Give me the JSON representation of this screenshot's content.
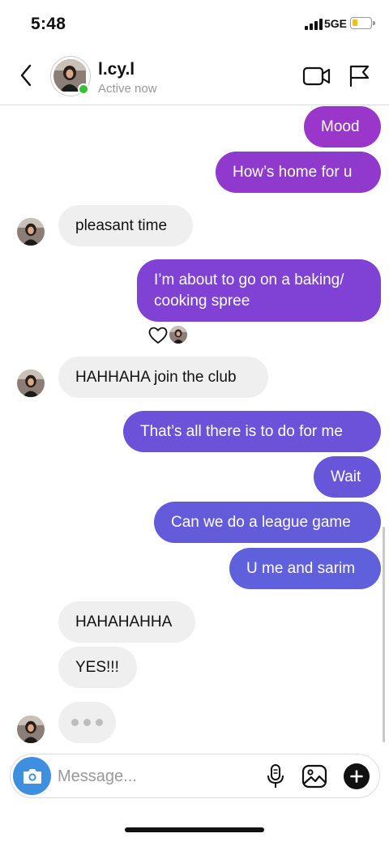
{
  "status_bar": {
    "time": "5:48",
    "network": "5GE"
  },
  "header": {
    "contact_name": "l.cy.l",
    "contact_status": "Active now"
  },
  "colors": {
    "sent_top": "#9a36c9",
    "sent_mid": "#7a45d6",
    "sent_bottom": "#5f60db",
    "received_bg": "#efefef",
    "active_green": "#35c02f",
    "camera_blue": "#3f8fe0"
  },
  "messages": [
    {
      "from": "me",
      "text": "Mood"
    },
    {
      "from": "me",
      "text": "How’s home for u"
    },
    {
      "from": "them",
      "text": "pleasant time"
    },
    {
      "from": "me",
      "text": "I’m about to go on a baking/ cooking spree",
      "reaction": "heart-icon"
    },
    {
      "from": "them",
      "text": "HAHHAHA join the club"
    },
    {
      "from": "me",
      "text": "That’s all there is to do for me"
    },
    {
      "from": "me",
      "text": "Wait"
    },
    {
      "from": "me",
      "text": "Can we do a league game"
    },
    {
      "from": "me",
      "text": "U me and sarim"
    },
    {
      "from": "them",
      "text": "HAHAHAHHA"
    },
    {
      "from": "them",
      "text": "YES!!!"
    }
  ],
  "typing_indicator": "typing-dots",
  "composer": {
    "placeholder": "Message..."
  },
  "icons": {
    "back": "chevron-left-icon",
    "video": "video-camera-icon",
    "flag": "flag-icon",
    "camera": "camera-icon",
    "mic": "microphone-icon",
    "gallery": "image-gallery-icon",
    "plus": "plus-icon"
  }
}
